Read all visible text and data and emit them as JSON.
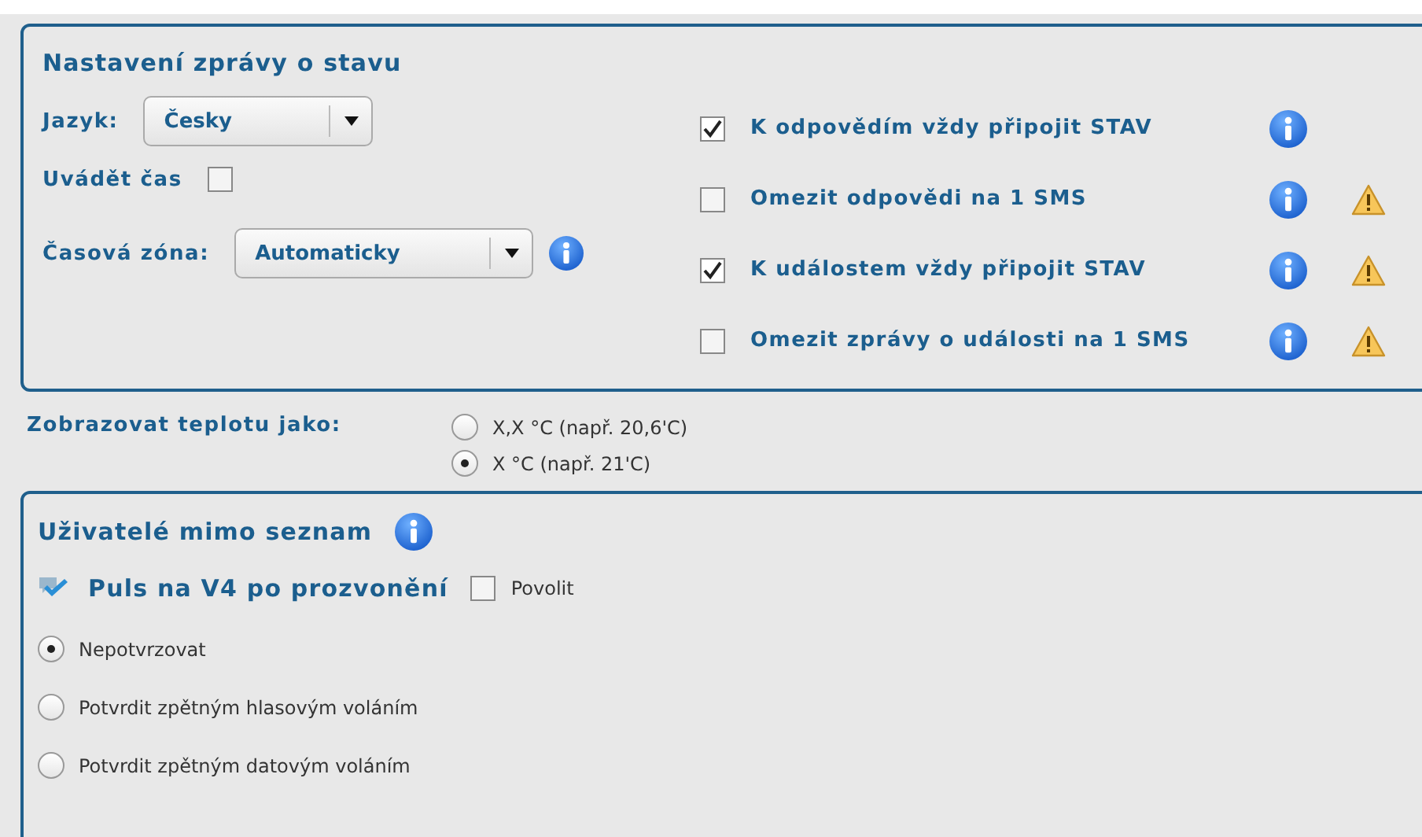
{
  "status_panel": {
    "title": "Nastavení zprávy o stavu",
    "language": {
      "label": "Jazyk:",
      "value": "Česky"
    },
    "show_time": {
      "label": "Uvádět čas",
      "checked": false
    },
    "timezone": {
      "label": "Časová zóna:",
      "value": "Automaticky"
    },
    "options": [
      {
        "label": "K odpovědím vždy připojit STAV",
        "checked": true,
        "warning": false
      },
      {
        "label": "Omezit odpovědi na 1 SMS",
        "checked": false,
        "warning": true
      },
      {
        "label": "K událostem vždy připojit STAV",
        "checked": true,
        "warning": true
      },
      {
        "label": "Omezit zprávy o události na 1 SMS",
        "checked": false,
        "warning": true
      }
    ]
  },
  "temperature": {
    "label": "Zobrazovat teplotu jako:",
    "options": [
      {
        "label": "X,X °C (např. 20,6'C)",
        "selected": false
      },
      {
        "label": "X °C (např. 21'C)",
        "selected": true
      }
    ]
  },
  "unlisted_users": {
    "title": "Uživatelé mimo seznam",
    "pulse": {
      "title": "Puls na V4 po prozvonění",
      "enable": {
        "label": "Povolit",
        "checked": false
      }
    },
    "confirm_options": [
      {
        "label": "Nepotvrzovat",
        "selected": true
      },
      {
        "label": "Potvrdit zpětným hlasovým voláním",
        "selected": false
      },
      {
        "label": "Potvrdit zpětným datovým voláním",
        "selected": false
      }
    ]
  }
}
